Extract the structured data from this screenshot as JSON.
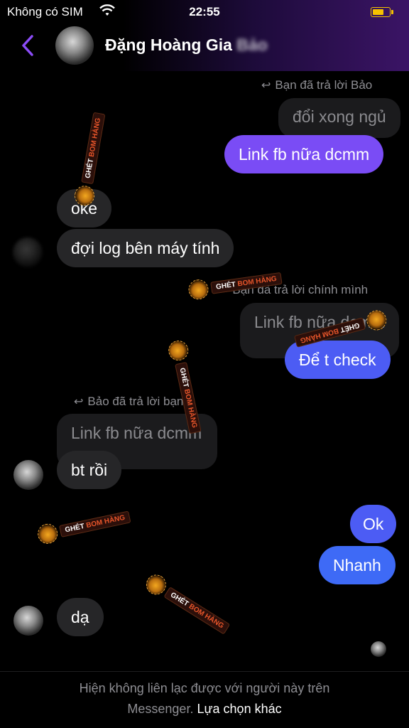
{
  "status_bar": {
    "carrier": "Không có SIM",
    "time": "22:55"
  },
  "header": {
    "title": "Đặng Hoàng Gia",
    "title_obscured": "Bảo"
  },
  "messages": {
    "reply_note_1": "Bạn đã trả lời Bảo",
    "quoted_1": "đổi xong ngủ",
    "out_1": "Link fb nữa dcmm",
    "in_1": "oke",
    "in_2": "đợi log bên máy tính",
    "reply_note_2": "Bạn đã trả lời chính mình",
    "quoted_2": "Link fb nữa dcmm",
    "out_2": "Để t check",
    "reply_note_3": "Bảo đã trả lời bạn",
    "quoted_3": "Link fb nữa dcmm",
    "in_3": "bt rồi",
    "out_3": "Ok",
    "out_4": "Nhanh",
    "in_4": "dạ"
  },
  "watermark": {
    "prefix": "GHÉT ",
    "highlight": "BOM HÀNG"
  },
  "footer": {
    "line1": "Hiện không liên lạc được với người này trên",
    "line2": "Messenger.",
    "link": "Lựa chọn khác"
  },
  "colors": {
    "bubble_incoming": "#262628",
    "bubble_outgoing_purple": "#7a4cf5",
    "bubble_outgoing_blue": "#4c5cf4",
    "accent_back": "#8b4cf7"
  },
  "icons": [
    "wifi-icon",
    "battery-icon",
    "back-arrow-icon",
    "reply-arrow-icon",
    "avatar"
  ]
}
